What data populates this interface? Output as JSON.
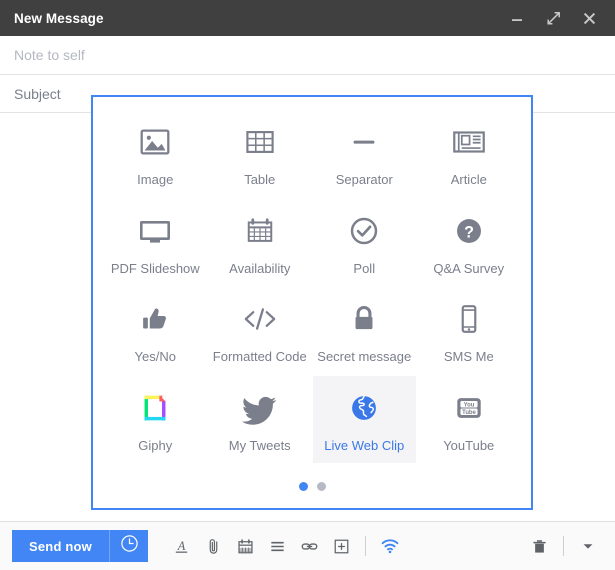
{
  "window": {
    "title": "New Message",
    "controls": [
      {
        "name": "minimize",
        "label": "Minimize"
      },
      {
        "name": "expand",
        "label": "Expand"
      },
      {
        "name": "close",
        "label": "Close"
      }
    ]
  },
  "compose": {
    "recipient_placeholder": "Note to self",
    "recipient_value": "",
    "subject_label": "Subject",
    "subject_value": ""
  },
  "insert_popup": {
    "items": [
      {
        "label": "Image",
        "icon": "image-icon",
        "selected": false
      },
      {
        "label": "Table",
        "icon": "table-icon",
        "selected": false
      },
      {
        "label": "Separator",
        "icon": "separator-icon",
        "selected": false
      },
      {
        "label": "Article",
        "icon": "article-icon",
        "selected": false
      },
      {
        "label": "PDF Slideshow",
        "icon": "monitor-icon",
        "selected": false
      },
      {
        "label": "Availability",
        "icon": "calendar-icon",
        "selected": false
      },
      {
        "label": "Poll",
        "icon": "check-circle-icon",
        "selected": false
      },
      {
        "label": "Q&A Survey",
        "icon": "question-circle-icon",
        "selected": false
      },
      {
        "label": "Yes/No",
        "icon": "thumbs-up-icon",
        "selected": false
      },
      {
        "label": "Formatted Code",
        "icon": "code-icon",
        "selected": false
      },
      {
        "label": "Secret message",
        "icon": "lock-icon",
        "selected": false
      },
      {
        "label": "SMS Me",
        "icon": "phone-icon",
        "selected": false
      },
      {
        "label": "Giphy",
        "icon": "giphy-icon",
        "selected": false
      },
      {
        "label": "My Tweets",
        "icon": "twitter-icon",
        "selected": false
      },
      {
        "label": "Live Web Clip",
        "icon": "globe-icon",
        "selected": true
      },
      {
        "label": "YouTube",
        "icon": "youtube-icon",
        "selected": false
      }
    ],
    "pages": [
      {
        "active": true
      },
      {
        "active": false
      }
    ]
  },
  "toolbar": {
    "send_label": "Send now",
    "schedule_icon": "clock-icon",
    "tools": [
      {
        "name": "format-text-icon"
      },
      {
        "name": "attach-file-icon"
      },
      {
        "name": "calendar-icon"
      },
      {
        "name": "list-icon"
      },
      {
        "name": "link-icon"
      },
      {
        "name": "insert-plus-icon"
      }
    ],
    "signal_icon": "wifi-icon",
    "trash_icon": "trash-icon",
    "more_icon": "chevron-down-icon"
  },
  "colors": {
    "accent": "#4285f4",
    "titlebar": "#404040",
    "icon_gray": "#7b7f8c",
    "selected_bg": "#f4f4f6"
  }
}
